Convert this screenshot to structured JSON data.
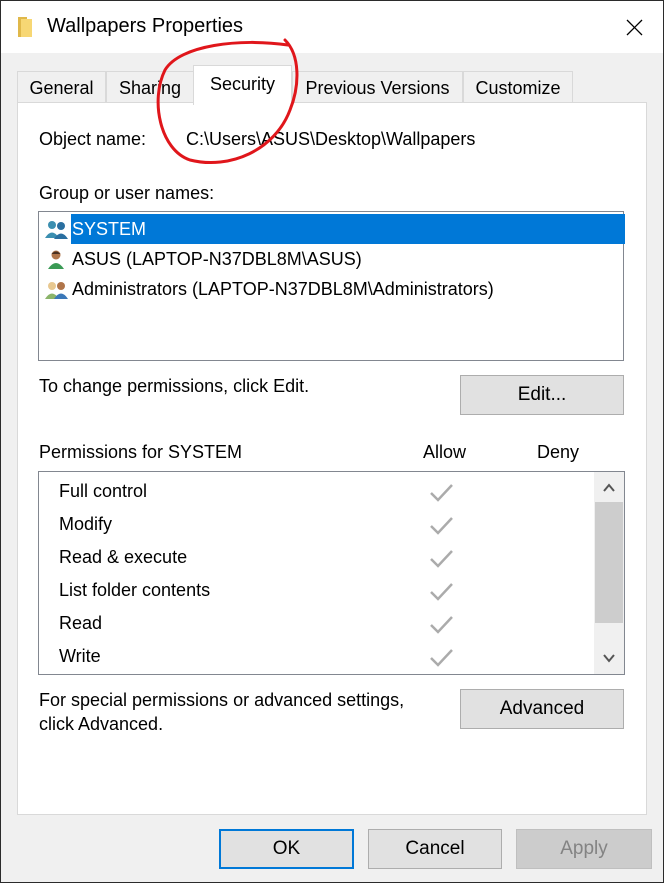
{
  "window": {
    "title": "Wallpapers Properties",
    "icon": "folder-icon",
    "close_icon": "close-icon"
  },
  "tabs": [
    {
      "label": "General",
      "active": false
    },
    {
      "label": "Sharing",
      "active": false
    },
    {
      "label": "Security",
      "active": true
    },
    {
      "label": "Previous Versions",
      "active": false
    },
    {
      "label": "Customize",
      "active": false
    }
  ],
  "security": {
    "object_name_label": "Object name:",
    "object_name_value": "C:\\Users\\ASUS\\Desktop\\Wallpapers",
    "group_label": "Group or user names:",
    "users": [
      {
        "name": "SYSTEM",
        "icon": "user-group-icon",
        "selected": true
      },
      {
        "name": "ASUS (LAPTOP-N37DBL8M\\ASUS)",
        "icon": "user-icon",
        "selected": false
      },
      {
        "name": "Administrators (LAPTOP-N37DBL8M\\Administrators)",
        "icon": "admin-group-icon",
        "selected": false
      }
    ],
    "change_hint": "To change permissions, click Edit.",
    "edit_button": "Edit...",
    "permissions_label": "Permissions for SYSTEM",
    "allow_header": "Allow",
    "deny_header": "Deny",
    "permissions": [
      {
        "name": "Full control",
        "allow": true,
        "deny": false
      },
      {
        "name": "Modify",
        "allow": true,
        "deny": false
      },
      {
        "name": "Read & execute",
        "allow": true,
        "deny": false
      },
      {
        "name": "List folder contents",
        "allow": true,
        "deny": false
      },
      {
        "name": "Read",
        "allow": true,
        "deny": false
      },
      {
        "name": "Write",
        "allow": true,
        "deny": false
      }
    ],
    "advanced_hint_line1": "For special permissions or advanced settings,",
    "advanced_hint_line2": "click Advanced.",
    "advanced_button": "Advanced"
  },
  "footer": {
    "ok": "OK",
    "cancel": "Cancel",
    "apply": "Apply"
  },
  "colors": {
    "selection": "#0078d7",
    "annotation": "#e0161b"
  }
}
